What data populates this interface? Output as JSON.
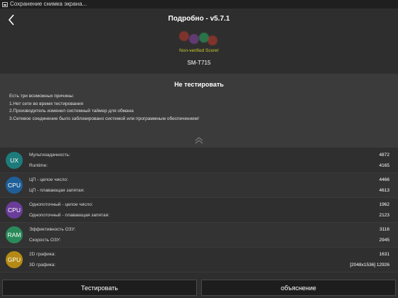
{
  "statusbar": {
    "text": "Сохранение снимка экрана..."
  },
  "header": {
    "title": "Подробно - v5.7.1",
    "score_note": "Non-verified Score!",
    "device": "SM-T715",
    "dot_colors": [
      "#c0392b",
      "#8e44ad",
      "#27ae60",
      "#c0392b"
    ]
  },
  "panel": {
    "title": "Не тестировать",
    "lines": [
      "Есть три возможных причины:",
      "1.Нет сети во время тестирования",
      "2.Производитель изменил системный таймер для обмана",
      "3.Сетевое соединение было заблокировано системой или программным обеспечением!"
    ]
  },
  "rows": [
    {
      "badge": "UX",
      "color": "#1e7b7b",
      "label1": "Мультизадачность:",
      "value1": "4872",
      "label2": "Runtime:",
      "value2": "4165"
    },
    {
      "badge": "CPU",
      "color": "#1f5f99",
      "label1": "ЦП - целое число:",
      "value1": "4466",
      "label2": "ЦП - плавающая запятая:",
      "value2": "4613"
    },
    {
      "badge": "CPU",
      "color": "#6a3d9a",
      "label1": "Однопоточный - целое число:",
      "value1": "1962",
      "label2": "Однопоточный - плавающая запятая:",
      "value2": "2123"
    },
    {
      "badge": "RAM",
      "color": "#2a8a5a",
      "label1": "Эффективность ОЗУ:",
      "value1": "3116",
      "label2": "Скорость ОЗУ:",
      "value2": "2945"
    },
    {
      "badge": "GPU",
      "color": "#b58a14",
      "label1": "2D графика:",
      "value1": "1631",
      "label2": "3D графика:",
      "value2": "[2048x1536] 12926"
    }
  ],
  "buttons": {
    "test": "Тестировать",
    "explain": "объяснение"
  },
  "colors": {
    "background": "#2e2e2e",
    "panel": "#3b3b3b",
    "note": "#c8c832"
  }
}
